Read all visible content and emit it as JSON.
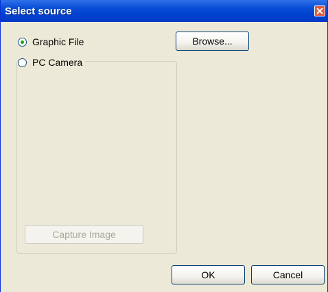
{
  "window": {
    "title": "Select source"
  },
  "title_bar": {
    "close_icon": "close-icon"
  },
  "options": {
    "graphic_file": {
      "label": "Graphic File",
      "selected": true
    },
    "pc_camera": {
      "label": "PC Camera",
      "selected": false
    }
  },
  "buttons": {
    "browse": "Browse...",
    "capture_image": "Capture Image",
    "ok": "OK",
    "cancel": "Cancel"
  },
  "colors": {
    "titlebar": "#0a4fd8",
    "dialog_background": "#ece9d8",
    "close_button": "#e0573a",
    "radio_dot": "#21a121"
  }
}
